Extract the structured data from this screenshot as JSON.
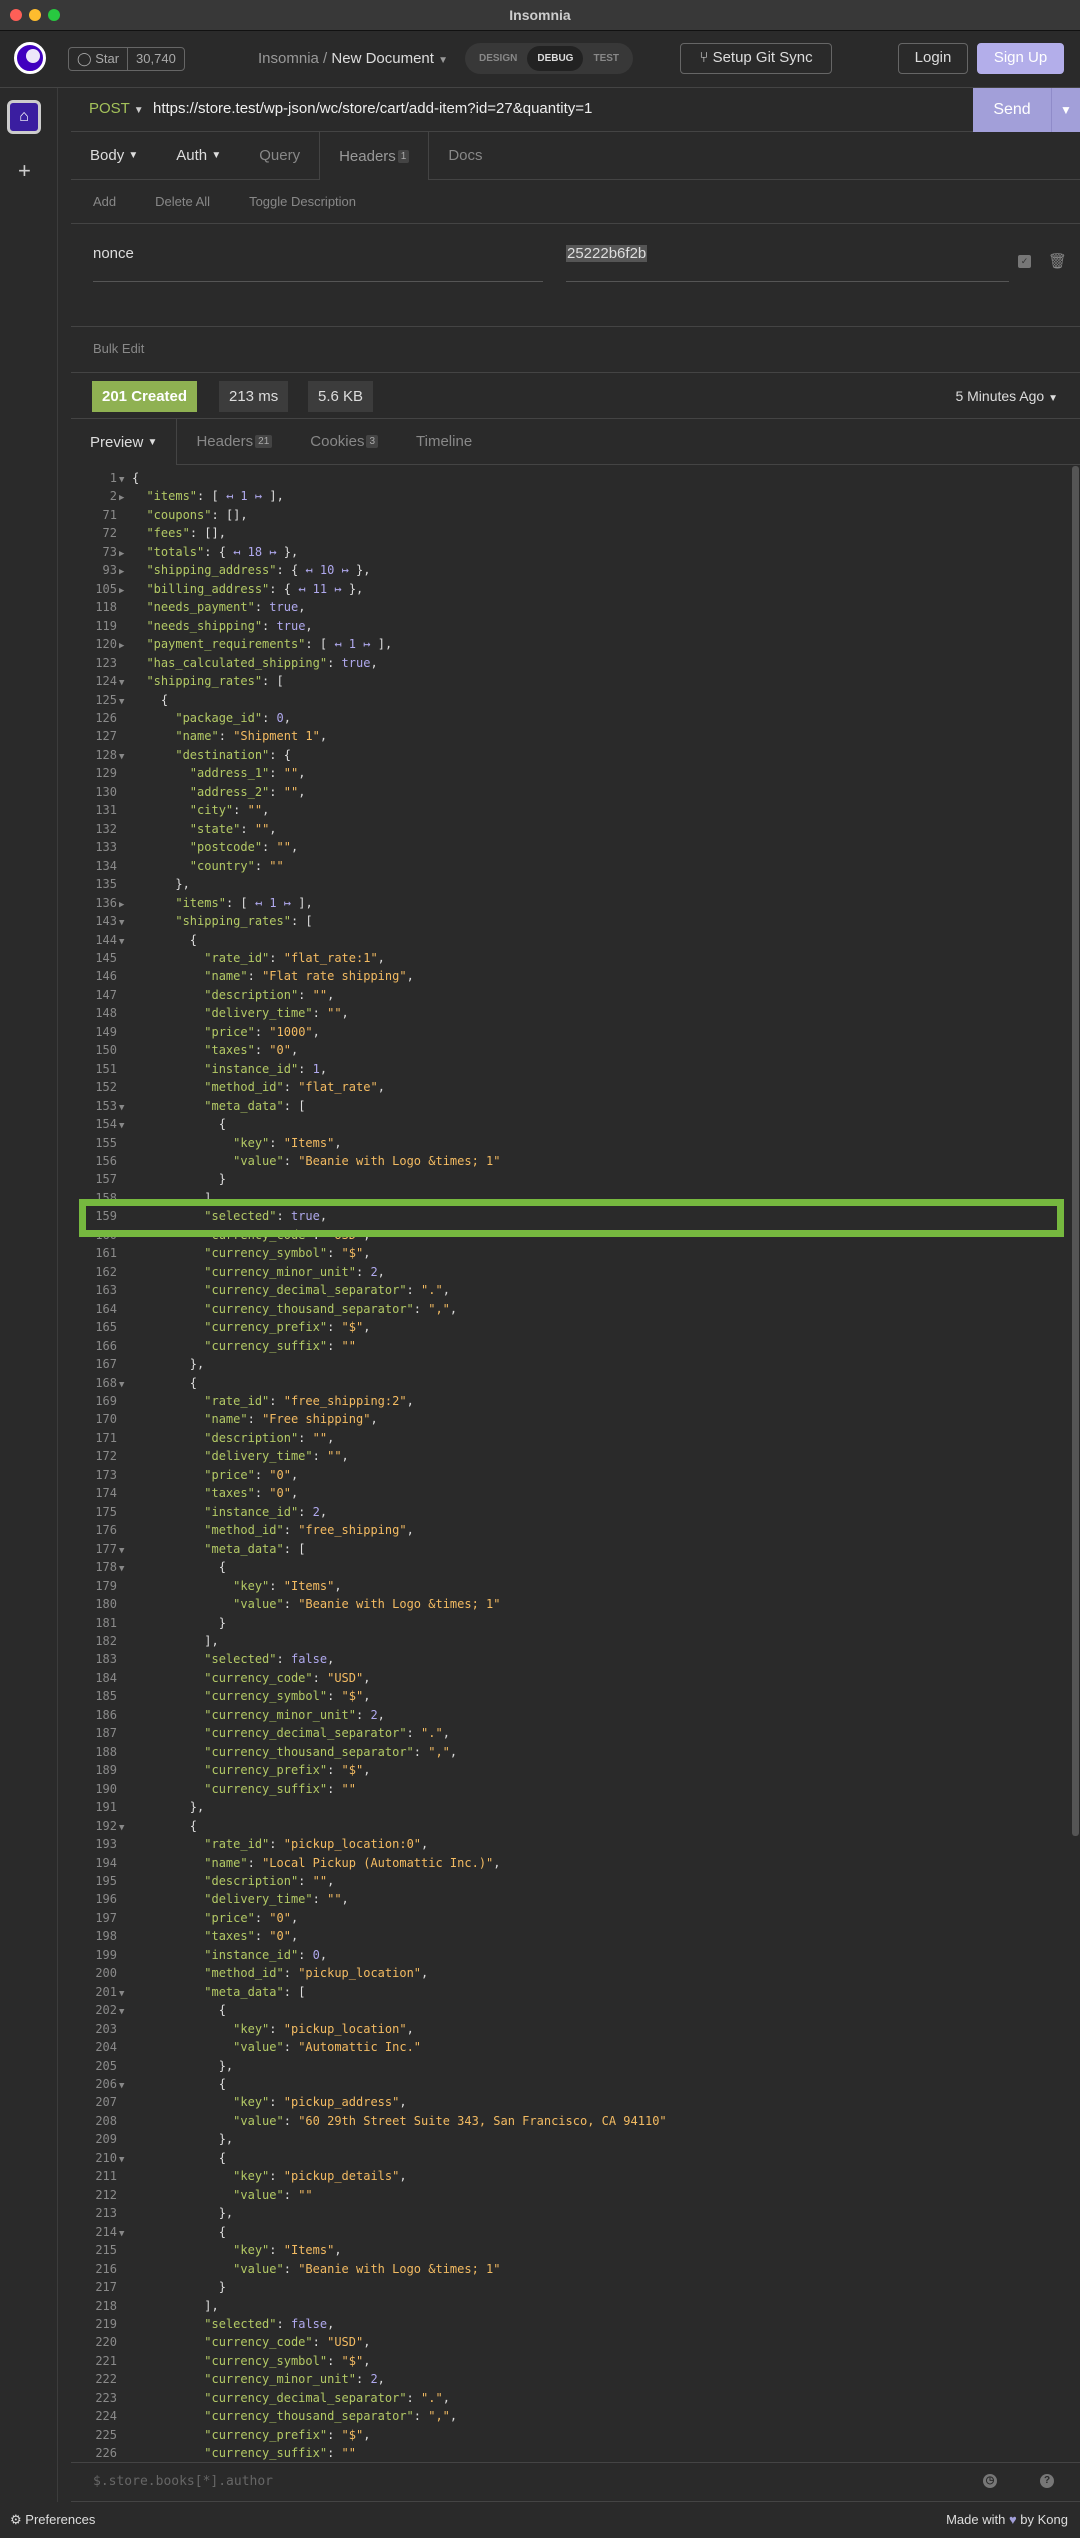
{
  "window": {
    "title": "Insomnia"
  },
  "header": {
    "star_label": "Star",
    "star_count": "30,740",
    "crumb_root": "Insomnia",
    "crumb_sep": "/",
    "document": "New Document",
    "modes": [
      "DESIGN",
      "DEBUG",
      "TEST"
    ],
    "active_mode": "DEBUG",
    "git_sync": "Setup Git Sync",
    "login": "Login",
    "signup": "Sign Up"
  },
  "request": {
    "method": "POST",
    "url": "https://store.test/wp-json/wc/store/cart/add-item?id=27&quantity=1",
    "send": "Send",
    "tabs": [
      {
        "label": "Body"
      },
      {
        "label": "Auth"
      },
      {
        "label": "Query"
      },
      {
        "label": "Headers",
        "badge": "1"
      },
      {
        "label": "Docs"
      }
    ],
    "actions": [
      "Add",
      "Delete All",
      "Toggle Description"
    ],
    "headers": [
      {
        "name": "nonce",
        "value": "25222b6f2b",
        "enabled": true
      }
    ],
    "bulk_edit": "Bulk Edit"
  },
  "response": {
    "status": "201 Created",
    "status_color": "#8fb152",
    "time": "213 ms",
    "size": "5.6 KB",
    "ago": "5 Minutes Ago",
    "tabs": [
      {
        "label": "Preview"
      },
      {
        "label": "Headers",
        "badge": "21"
      },
      {
        "label": "Cookies",
        "badge": "3"
      },
      {
        "label": "Timeline"
      }
    ],
    "filter_placeholder": "$.store.books[*].author",
    "highlighted_line": 159,
    "lines": [
      {
        "n": 1,
        "f": "d",
        "t": "{"
      },
      {
        "n": 2,
        "f": "r",
        "t": "  \"items\": [ ↤ 1 ↦ ],"
      },
      {
        "n": 71,
        "t": "  \"coupons\": [],"
      },
      {
        "n": 72,
        "t": "  \"fees\": [],"
      },
      {
        "n": 73,
        "f": "r",
        "t": "  \"totals\": { ↤ 18 ↦ },"
      },
      {
        "n": 93,
        "f": "r",
        "t": "  \"shipping_address\": { ↤ 10 ↦ },"
      },
      {
        "n": 105,
        "f": "r",
        "t": "  \"billing_address\": { ↤ 11 ↦ },"
      },
      {
        "n": 118,
        "t": "  \"needs_payment\": true,"
      },
      {
        "n": 119,
        "t": "  \"needs_shipping\": true,"
      },
      {
        "n": 120,
        "f": "r",
        "t": "  \"payment_requirements\": [ ↤ 1 ↦ ],"
      },
      {
        "n": 123,
        "t": "  \"has_calculated_shipping\": true,"
      },
      {
        "n": 124,
        "f": "d",
        "t": "  \"shipping_rates\": ["
      },
      {
        "n": 125,
        "f": "d",
        "t": "    {"
      },
      {
        "n": 126,
        "t": "      \"package_id\": 0,"
      },
      {
        "n": 127,
        "t": "      \"name\": \"Shipment 1\","
      },
      {
        "n": 128,
        "f": "d",
        "t": "      \"destination\": {"
      },
      {
        "n": 129,
        "t": "        \"address_1\": \"\","
      },
      {
        "n": 130,
        "t": "        \"address_2\": \"\","
      },
      {
        "n": 131,
        "t": "        \"city\": \"\","
      },
      {
        "n": 132,
        "t": "        \"state\": \"\","
      },
      {
        "n": 133,
        "t": "        \"postcode\": \"\","
      },
      {
        "n": 134,
        "t": "        \"country\": \"\""
      },
      {
        "n": 135,
        "t": "      },"
      },
      {
        "n": 136,
        "f": "r",
        "t": "      \"items\": [ ↤ 1 ↦ ],"
      },
      {
        "n": 143,
        "f": "d",
        "t": "      \"shipping_rates\": ["
      },
      {
        "n": 144,
        "f": "d",
        "t": "        {"
      },
      {
        "n": 145,
        "t": "          \"rate_id\": \"flat_rate:1\","
      },
      {
        "n": 146,
        "t": "          \"name\": \"Flat rate shipping\","
      },
      {
        "n": 147,
        "t": "          \"description\": \"\","
      },
      {
        "n": 148,
        "t": "          \"delivery_time\": \"\","
      },
      {
        "n": 149,
        "t": "          \"price\": \"1000\","
      },
      {
        "n": 150,
        "t": "          \"taxes\": \"0\","
      },
      {
        "n": 151,
        "t": "          \"instance_id\": 1,"
      },
      {
        "n": 152,
        "t": "          \"method_id\": \"flat_rate\","
      },
      {
        "n": 153,
        "f": "d",
        "t": "          \"meta_data\": ["
      },
      {
        "n": 154,
        "f": "d",
        "t": "            {"
      },
      {
        "n": 155,
        "t": "              \"key\": \"Items\","
      },
      {
        "n": 156,
        "t": "              \"value\": \"Beanie with Logo &times; 1\""
      },
      {
        "n": 157,
        "t": "            }"
      },
      {
        "n": 158,
        "t": "          ],"
      },
      {
        "n": 159,
        "t": "          \"selected\": true,"
      },
      {
        "n": 160,
        "t": "          \"currency_code\": \"USD\","
      },
      {
        "n": 161,
        "t": "          \"currency_symbol\": \"$\","
      },
      {
        "n": 162,
        "t": "          \"currency_minor_unit\": 2,"
      },
      {
        "n": 163,
        "t": "          \"currency_decimal_separator\": \".\","
      },
      {
        "n": 164,
        "t": "          \"currency_thousand_separator\": \",\","
      },
      {
        "n": 165,
        "t": "          \"currency_prefix\": \"$\","
      },
      {
        "n": 166,
        "t": "          \"currency_suffix\": \"\""
      },
      {
        "n": 167,
        "t": "        },"
      },
      {
        "n": 168,
        "f": "d",
        "t": "        {"
      },
      {
        "n": 169,
        "t": "          \"rate_id\": \"free_shipping:2\","
      },
      {
        "n": 170,
        "t": "          \"name\": \"Free shipping\","
      },
      {
        "n": 171,
        "t": "          \"description\": \"\","
      },
      {
        "n": 172,
        "t": "          \"delivery_time\": \"\","
      },
      {
        "n": 173,
        "t": "          \"price\": \"0\","
      },
      {
        "n": 174,
        "t": "          \"taxes\": \"0\","
      },
      {
        "n": 175,
        "t": "          \"instance_id\": 2,"
      },
      {
        "n": 176,
        "t": "          \"method_id\": \"free_shipping\","
      },
      {
        "n": 177,
        "f": "d",
        "t": "          \"meta_data\": ["
      },
      {
        "n": 178,
        "f": "d",
        "t": "            {"
      },
      {
        "n": 179,
        "t": "              \"key\": \"Items\","
      },
      {
        "n": 180,
        "t": "              \"value\": \"Beanie with Logo &times; 1\""
      },
      {
        "n": 181,
        "t": "            }"
      },
      {
        "n": 182,
        "t": "          ],"
      },
      {
        "n": 183,
        "t": "          \"selected\": false,"
      },
      {
        "n": 184,
        "t": "          \"currency_code\": \"USD\","
      },
      {
        "n": 185,
        "t": "          \"currency_symbol\": \"$\","
      },
      {
        "n": 186,
        "t": "          \"currency_minor_unit\": 2,"
      },
      {
        "n": 187,
        "t": "          \"currency_decimal_separator\": \".\","
      },
      {
        "n": 188,
        "t": "          \"currency_thousand_separator\": \",\","
      },
      {
        "n": 189,
        "t": "          \"currency_prefix\": \"$\","
      },
      {
        "n": 190,
        "t": "          \"currency_suffix\": \"\""
      },
      {
        "n": 191,
        "t": "        },"
      },
      {
        "n": 192,
        "f": "d",
        "t": "        {"
      },
      {
        "n": 193,
        "t": "          \"rate_id\": \"pickup_location:0\","
      },
      {
        "n": 194,
        "t": "          \"name\": \"Local Pickup (Automattic Inc.)\","
      },
      {
        "n": 195,
        "t": "          \"description\": \"\","
      },
      {
        "n": 196,
        "t": "          \"delivery_time\": \"\","
      },
      {
        "n": 197,
        "t": "          \"price\": \"0\","
      },
      {
        "n": 198,
        "t": "          \"taxes\": \"0\","
      },
      {
        "n": 199,
        "t": "          \"instance_id\": 0,"
      },
      {
        "n": 200,
        "t": "          \"method_id\": \"pickup_location\","
      },
      {
        "n": 201,
        "f": "d",
        "t": "          \"meta_data\": ["
      },
      {
        "n": 202,
        "f": "d",
        "t": "            {"
      },
      {
        "n": 203,
        "t": "              \"key\": \"pickup_location\","
      },
      {
        "n": 204,
        "t": "              \"value\": \"Automattic Inc.\""
      },
      {
        "n": 205,
        "t": "            },"
      },
      {
        "n": 206,
        "f": "d",
        "t": "            {"
      },
      {
        "n": 207,
        "t": "              \"key\": \"pickup_address\","
      },
      {
        "n": 208,
        "t": "              \"value\": \"60 29th Street Suite 343, San Francisco, CA 94110\""
      },
      {
        "n": 209,
        "t": "            },"
      },
      {
        "n": 210,
        "f": "d",
        "t": "            {"
      },
      {
        "n": 211,
        "t": "              \"key\": \"pickup_details\","
      },
      {
        "n": 212,
        "t": "              \"value\": \"\""
      },
      {
        "n": 213,
        "t": "            },"
      },
      {
        "n": 214,
        "f": "d",
        "t": "            {"
      },
      {
        "n": 215,
        "t": "              \"key\": \"Items\","
      },
      {
        "n": 216,
        "t": "              \"value\": \"Beanie with Logo &times; 1\""
      },
      {
        "n": 217,
        "t": "            }"
      },
      {
        "n": 218,
        "t": "          ],"
      },
      {
        "n": 219,
        "t": "          \"selected\": false,"
      },
      {
        "n": 220,
        "t": "          \"currency_code\": \"USD\","
      },
      {
        "n": 221,
        "t": "          \"currency_symbol\": \"$\","
      },
      {
        "n": 222,
        "t": "          \"currency_minor_unit\": 2,"
      },
      {
        "n": 223,
        "t": "          \"currency_decimal_separator\": \".\","
      },
      {
        "n": 224,
        "t": "          \"currency_thousand_separator\": \",\","
      },
      {
        "n": 225,
        "t": "          \"currency_prefix\": \"$\","
      },
      {
        "n": 226,
        "t": "          \"currency_suffix\": \"\""
      }
    ]
  },
  "footer": {
    "preferences": "Preferences",
    "made_with": "Made with",
    "by": "by Kong"
  },
  "colors": {
    "accent": "#a29fd9",
    "highlight_box": "#76b83f"
  }
}
